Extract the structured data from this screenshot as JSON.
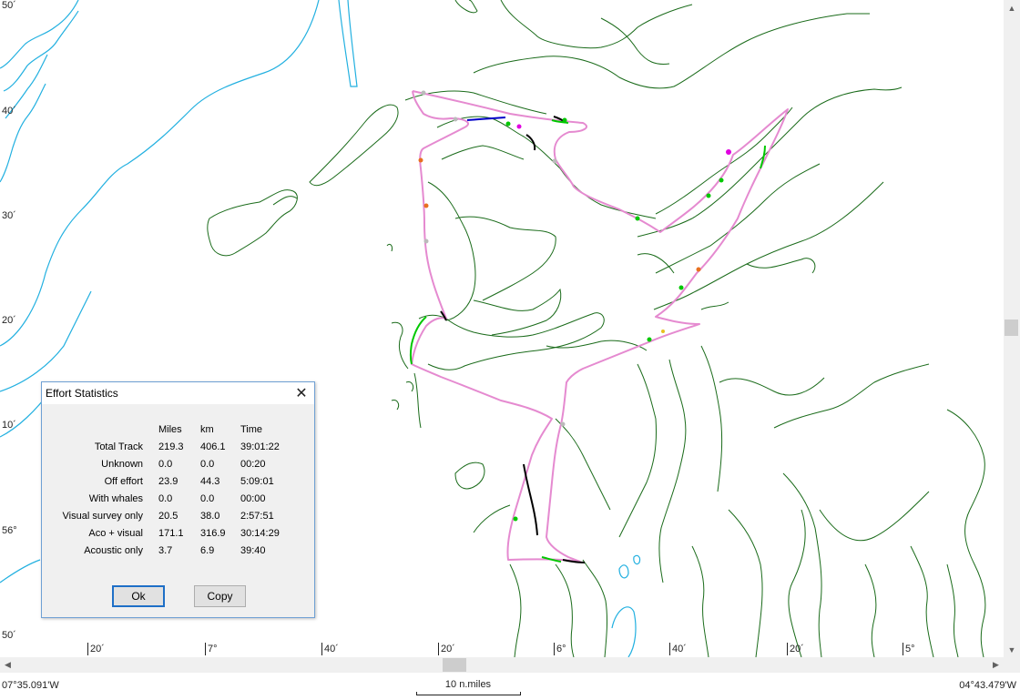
{
  "map": {
    "lat_labels": [
      "50´",
      "40´",
      "30´",
      "20´",
      "10´",
      "56°",
      "50´"
    ],
    "lon_labels": [
      "20´",
      "7°",
      "40´",
      "20´",
      "6°",
      "40´",
      "20´",
      "5°"
    ],
    "colors": {
      "coastline": "#1a6b1a",
      "depth_contour": "#22b0e0",
      "track": "#e58ad0",
      "track_aco_only": "#00c800",
      "track_off_effort": "#000000",
      "track_visual_only": "#0000c8",
      "marker_orange": "#e87020",
      "marker_magenta": "#e000e0",
      "marker_grey": "#bbbbbb"
    }
  },
  "status": {
    "left_coord": "07°35.091'W",
    "right_coord": "04°43.479'W",
    "scale_label": "10 n.miles"
  },
  "dialog": {
    "title": "Effort Statistics",
    "close_icon": "close-icon",
    "columns": [
      "Miles",
      "km",
      "Time"
    ],
    "rows": [
      {
        "label": "Total Track",
        "miles": "219.3",
        "km": "406.1",
        "time": "39:01:22"
      },
      {
        "label": "Unknown",
        "miles": "0.0",
        "km": "0.0",
        "time": "00:20"
      },
      {
        "label": "Off effort",
        "miles": "23.9",
        "km": "44.3",
        "time": "5:09:01"
      },
      {
        "label": "With whales",
        "miles": "0.0",
        "km": "0.0",
        "time": "00:00"
      },
      {
        "label": "Visual survey only",
        "miles": "20.5",
        "km": "38.0",
        "time": "2:57:51"
      },
      {
        "label": "Aco + visual",
        "miles": "171.1",
        "km": "316.9",
        "time": "30:14:29"
      },
      {
        "label": "Acoustic only",
        "miles": "3.7",
        "km": "6.9",
        "time": "39:40"
      }
    ],
    "ok_label": "Ok",
    "copy_label": "Copy"
  }
}
